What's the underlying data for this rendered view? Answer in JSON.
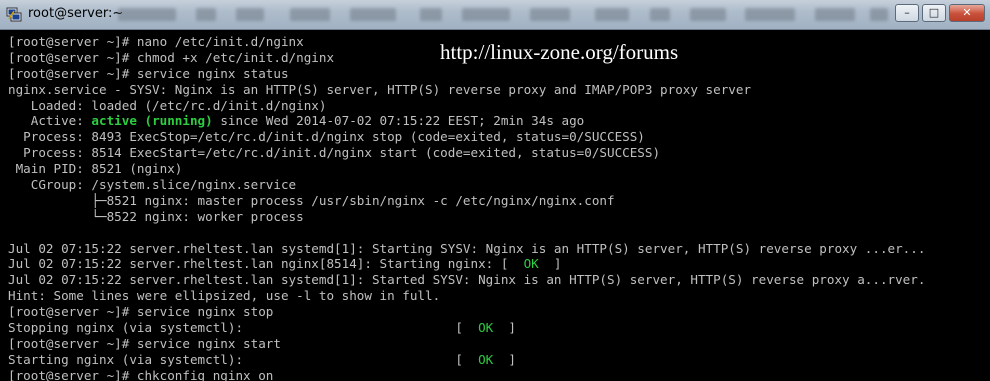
{
  "window": {
    "title": "root@server:~",
    "buttons": {
      "minimize": "–",
      "maximize": "□",
      "close": "✕"
    }
  },
  "watermark": "http://linux-zone.org/forums",
  "terminal": {
    "lines": [
      "[root@server ~]# nano /etc/init.d/nginx",
      "[root@server ~]# chmod +x /etc/init.d/nginx",
      "[root@server ~]# service nginx status",
      "nginx.service - SYSV: Nginx is an HTTP(S) server, HTTP(S) reverse proxy and IMAP/POP3 proxy server",
      "   Loaded: loaded (/etc/rc.d/init.d/nginx)",
      {
        "pre": "   Active: ",
        "hl": "active (running)",
        "post": " since Wed 2014-07-02 07:15:22 EEST; 2min 34s ago"
      },
      "  Process: 8493 ExecStop=/etc/rc.d/init.d/nginx stop (code=exited, status=0/SUCCESS)",
      "  Process: 8514 ExecStart=/etc/rc.d/init.d/nginx start (code=exited, status=0/SUCCESS)",
      " Main PID: 8521 (nginx)",
      "   CGroup: /system.slice/nginx.service",
      "           ├─8521 nginx: master process /usr/sbin/nginx -c /etc/nginx/nginx.conf",
      "           └─8522 nginx: worker process",
      "",
      "Jul 02 07:15:22 server.rheltest.lan systemd[1]: Starting SYSV: Nginx is an HTTP(S) server, HTTP(S) reverse proxy ...er...",
      {
        "pre": "Jul 02 07:15:22 server.rheltest.lan nginx[8514]: Starting nginx: [  ",
        "ok": "OK",
        "post": "  ]"
      },
      "Jul 02 07:15:22 server.rheltest.lan systemd[1]: Started SYSV: Nginx is an HTTP(S) server, HTTP(S) reverse proxy a...rver.",
      "Hint: Some lines were ellipsized, use -l to show in full.",
      "[root@server ~]# service nginx stop",
      {
        "pre": "Stopping nginx (via systemctl):                            [  ",
        "ok": "OK",
        "post": "  ]"
      },
      "[root@server ~]# service nginx start",
      {
        "pre": "Starting nginx (via systemctl):                            [  ",
        "ok": "OK",
        "post": "  ]"
      },
      "[root@server ~]# chkconfig nginx on"
    ]
  },
  "colors": {
    "terminal_bg": "#000000",
    "terminal_fg": "#c0c0c0",
    "highlight_green": "#2ecc40",
    "titlebar": "#aebccb"
  }
}
